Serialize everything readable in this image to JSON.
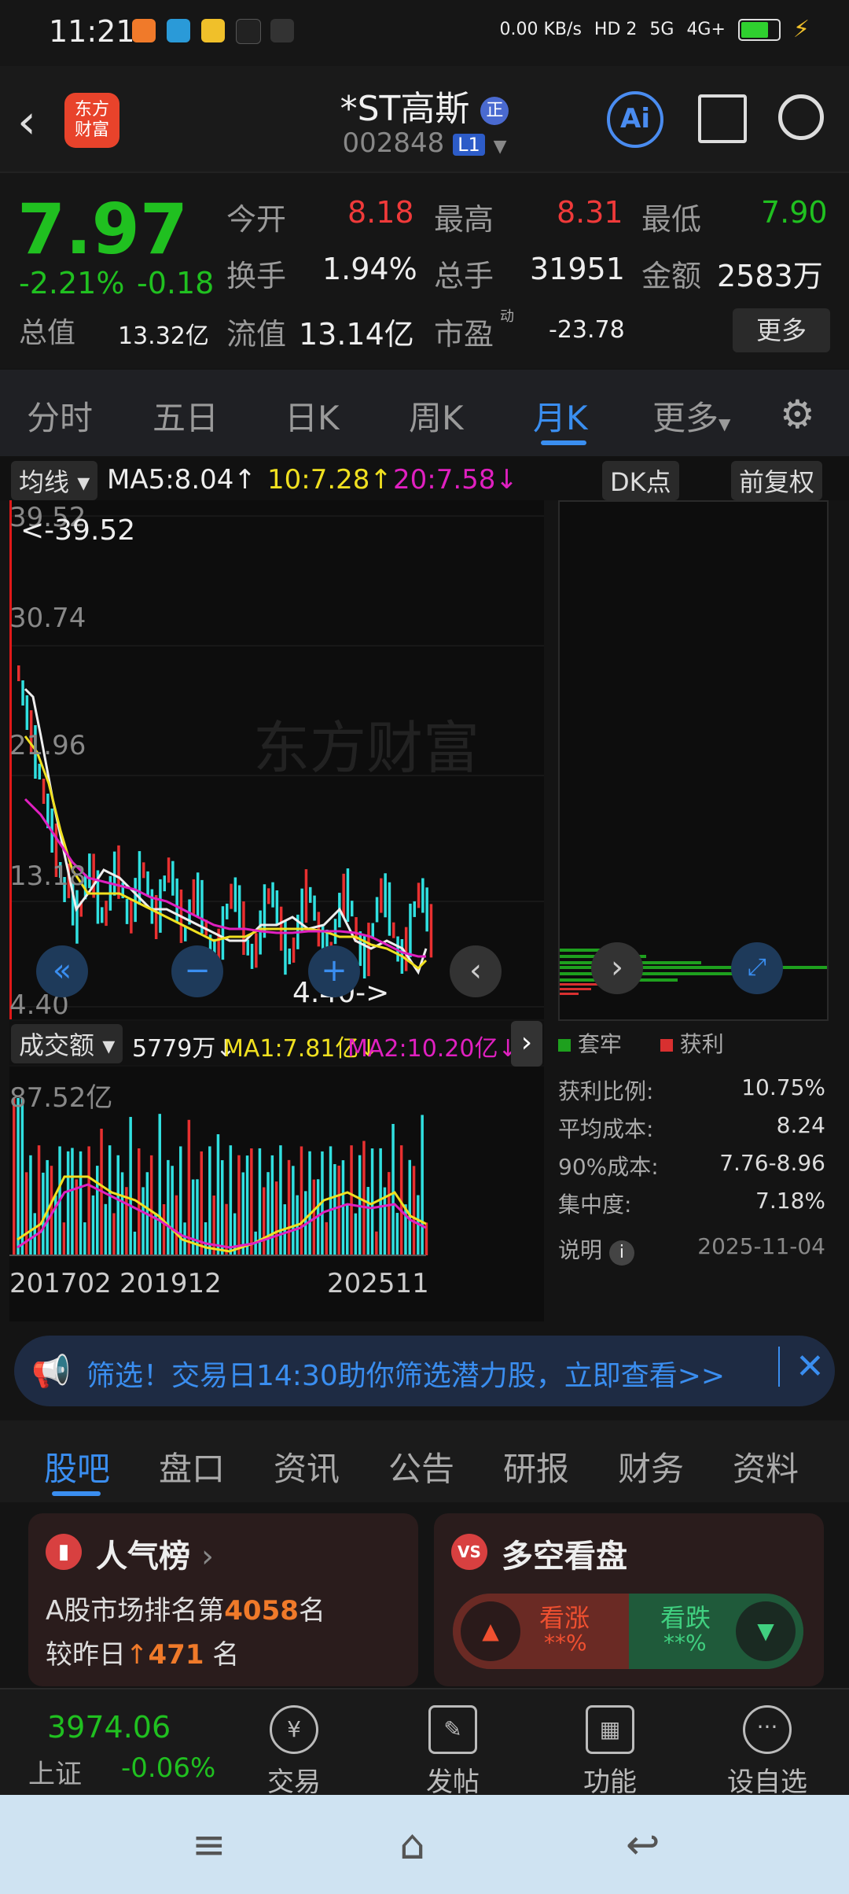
{
  "status_bar": {
    "time": "11:21",
    "net_speed": "0.00 KB/s",
    "hd": "HD 2",
    "sig1": "5G",
    "sig2": "4G+"
  },
  "header": {
    "back_icon": "chevron-left-icon",
    "logo_text_line1": "东方",
    "logo_text_line2": "财富",
    "title": "*ST高斯",
    "title_badge": "正",
    "code": "002848",
    "level_tag": "L1",
    "ai_label": "Ai"
  },
  "quote": {
    "price": "7.97",
    "change_pct": "-2.21%",
    "change_amt": "-0.18",
    "open_label": "今开",
    "open": "8.18",
    "high_label": "最高",
    "high": "8.31",
    "low_label": "最低",
    "low": "7.90",
    "turnover_label": "换手",
    "turnover": "1.94%",
    "volume_label": "总手",
    "volume": "31951",
    "amount_label": "金额",
    "amount": "2583万",
    "mktcap_label": "总值",
    "mktcap": "13.32亿",
    "float_label": "流值",
    "float": "13.14亿",
    "pe_label": "市盈",
    "pe_sup": "动",
    "pe": "-23.78",
    "more_label": "更多"
  },
  "tabs": [
    "分时",
    "五日",
    "日K",
    "周K",
    "月K",
    "更多"
  ],
  "chart_controls": {
    "ma_label": "均线",
    "ma5": "MA5:8.04",
    "ma10": "10:7.28",
    "ma20": "20:7.58",
    "dk_label": "DK点",
    "adjust_label": "前复权",
    "max_marker": "<-39.52",
    "min_marker": "4.40->",
    "y_ticks": [
      "39.52",
      "30.74",
      "21.96",
      "13.18",
      "4.40"
    ],
    "vol_label": "成交额",
    "vol_value": "5779万",
    "ma1": "MA1:7.81亿",
    "ma2": "MA2:10.20亿",
    "vol_max": "87.52亿",
    "x_labels": [
      "201702",
      "201912",
      "202511"
    ]
  },
  "chip": {
    "legend_trap": "套牢",
    "legend_profit": "获利",
    "rows": [
      {
        "label": "获利比例:",
        "value": "10.75%"
      },
      {
        "label": "平均成本:",
        "value": "8.24"
      },
      {
        "label": "90%成本:",
        "value": "7.76-8.96"
      },
      {
        "label": "集中度:",
        "value": "7.18%"
      }
    ],
    "note_label": "说明",
    "date": "2025-11-04"
  },
  "banner": {
    "text": "筛选！交易日14:30助你筛选潜力股，立即查看>>"
  },
  "subtabs": [
    "股吧",
    "盘口",
    "资讯",
    "公告",
    "研报",
    "财务",
    "资料"
  ],
  "popularity": {
    "title": "人气榜",
    "line1_prefix": "A股市场排名第",
    "rank": "4058",
    "line1_suffix": "名",
    "line2_prefix": "较昨日",
    "delta": "471",
    "line2_suffix": "名"
  },
  "sentiment": {
    "title": "多空看盘",
    "up_label": "看涨",
    "up_value": "**%",
    "down_label": "看跌",
    "down_value": "**%"
  },
  "bottom_bar": {
    "index_value": "3974.06",
    "index_name": "上证",
    "index_change": "-0.06%",
    "items": [
      "交易",
      "发帖",
      "功能",
      "设自选"
    ]
  },
  "chart_data": {
    "type": "line",
    "title": "",
    "ylim": [
      4.4,
      39.52
    ],
    "x_range_labels": [
      "201702",
      "201912",
      "202511"
    ]
  }
}
